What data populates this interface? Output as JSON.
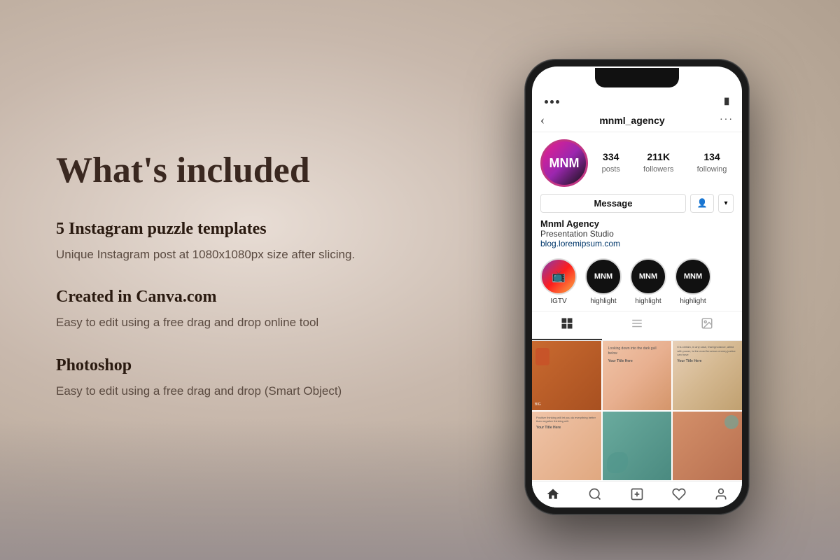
{
  "background": {
    "color": "#d4c4b8"
  },
  "left_panel": {
    "main_title": "What's included",
    "sections": [
      {
        "title": "5 Instagram puzzle templates",
        "description": "Unique Instagram post at 1080x1080px size after slicing."
      },
      {
        "title": "Created in Canva.com",
        "description": "Easy to edit using a free drag and drop online tool"
      },
      {
        "title": "Photoshop",
        "description": "Easy to edit using a free drag and drop (Smart Object)"
      }
    ]
  },
  "phone": {
    "status_dots": 3,
    "instagram": {
      "header": {
        "back_icon": "‹",
        "username": "mnml_agency",
        "more_icon": "···"
      },
      "profile": {
        "avatar_text": "MNM",
        "stats": [
          {
            "number": "334",
            "label": "posts"
          },
          {
            "number": "211K",
            "label": "followers"
          },
          {
            "number": "134",
            "label": "following"
          }
        ],
        "message_btn": "Message",
        "follow_icon": "👤+",
        "dropdown_icon": "▾",
        "bio_name": "Mnml Agency",
        "bio_desc": "Presentation Studio",
        "bio_link": "blog.loremipsum.com"
      },
      "highlights": [
        {
          "type": "igtv",
          "label": "IGTV"
        },
        {
          "type": "mnml",
          "label": "highlight"
        },
        {
          "type": "mnml",
          "label": "highlight"
        },
        {
          "type": "mnml",
          "label": "highlight"
        }
      ],
      "tabs": [
        {
          "icon": "⊞",
          "active": true
        },
        {
          "icon": "☰",
          "active": false
        },
        {
          "icon": "👤",
          "active": false
        }
      ],
      "bottom_nav": [
        {
          "icon": "⌂",
          "label": "home"
        },
        {
          "icon": "○",
          "label": "search"
        },
        {
          "icon": "⊕",
          "label": "add"
        },
        {
          "icon": "♡",
          "label": "activity"
        },
        {
          "icon": "👤",
          "label": "profile"
        }
      ]
    }
  }
}
